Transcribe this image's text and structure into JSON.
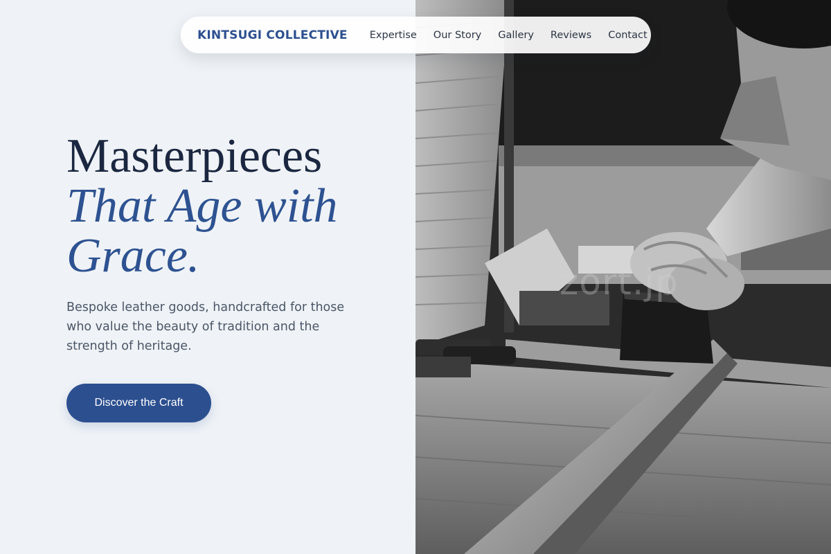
{
  "nav": {
    "brand": "KINTSUGI COLLECTIVE",
    "links": [
      "Expertise",
      "Our Story",
      "Gallery",
      "Reviews",
      "Contact"
    ]
  },
  "hero": {
    "headline_line1": "Masterpieces",
    "headline_line2": "That Age with Grace.",
    "subtext": "Bespoke leather goods, handcrafted for those who value the beauty of tradition and the strength of heritage.",
    "cta_label": "Discover the Craft"
  },
  "photo": {
    "watermark": "zort.jp",
    "description_icon": "craftsman-photo"
  },
  "colors": {
    "accent": "#2c4f8f",
    "headline_dark": "#1b2740",
    "headline_italic": "#2e5291",
    "background": "#eff3f7",
    "body_text": "#4a5566"
  }
}
